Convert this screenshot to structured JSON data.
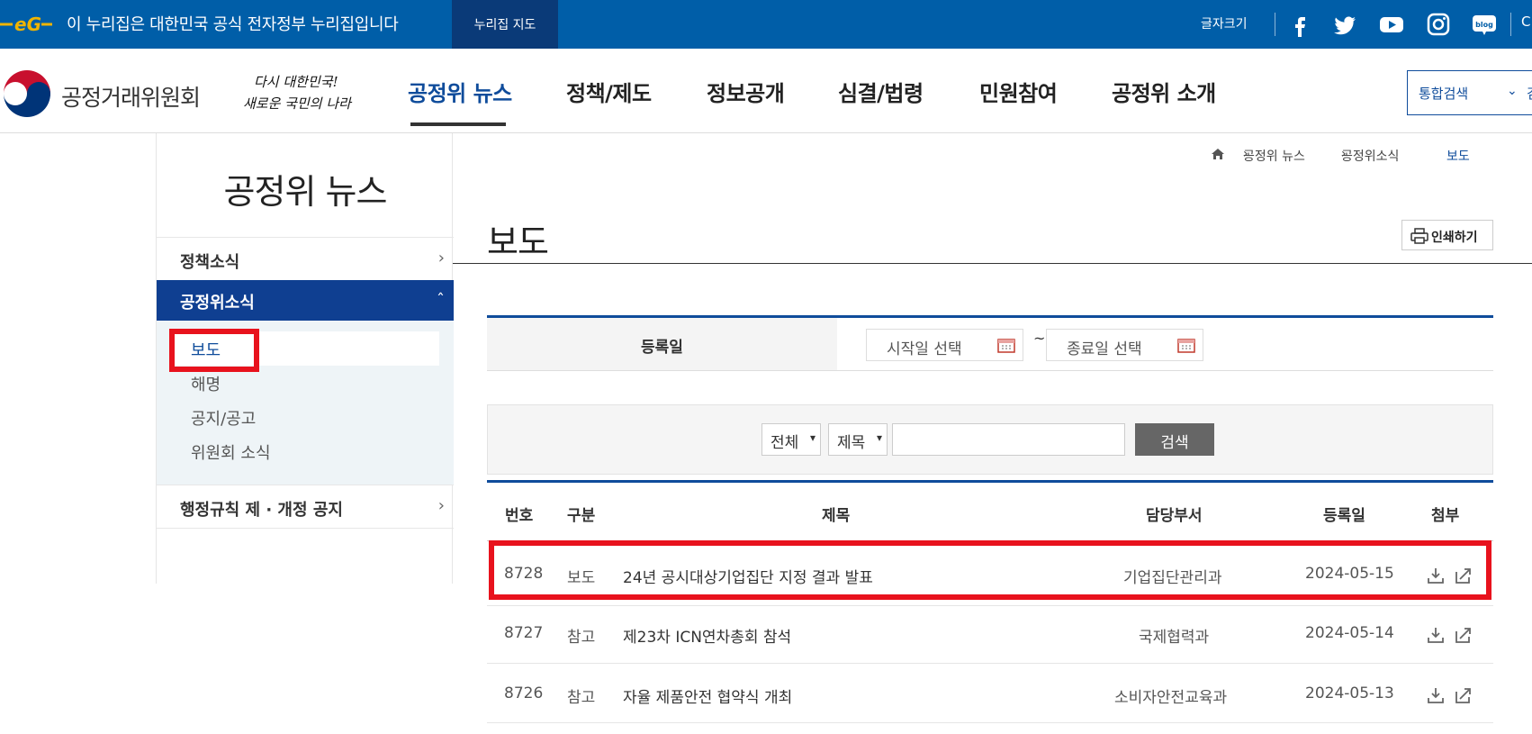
{
  "topbar": {
    "gov_text": "이 누리집은 대한민국 공식 전자정부 누리집입니다",
    "nuri_map": "누리집 지도",
    "font_size": "글자크기",
    "sns": [
      "facebook-icon",
      "twitter-icon",
      "youtube-icon",
      "instagram-icon",
      "blog-icon"
    ],
    "blog_label": "blog",
    "cut_text": "C"
  },
  "header": {
    "org_name": "공정거래위원회",
    "slogan_line1": "다시 대한민국!",
    "slogan_line2": "새로운 국민의 나라",
    "gnb": [
      "공정위 뉴스",
      "정책/제도",
      "정보공개",
      "심결/법령",
      "민원참여",
      "공정위 소개"
    ],
    "search_select": "통합검색",
    "search_cut": "검"
  },
  "sidenav": {
    "title": "공정위 뉴스",
    "groups": [
      "정책소식",
      "공정위소식",
      "행정규칙 제 · 개정 공지"
    ],
    "sub_items": [
      "보도",
      "해명",
      "공지/공고",
      "위원회 소식"
    ]
  },
  "breadcrumb": [
    "공정위 뉴스",
    "공정위소식",
    "보도"
  ],
  "page": {
    "title": "보도",
    "print": "인쇄하기"
  },
  "filter": {
    "date_label": "등록일",
    "start_placeholder": "시작일 선택",
    "end_placeholder": "종료일 선택",
    "tilde": "~",
    "scope": "전체",
    "field": "제목",
    "keyword": "",
    "search": "검색"
  },
  "table": {
    "headers": [
      "번호",
      "구분",
      "제목",
      "담당부서",
      "등록일",
      "첨부"
    ],
    "rows": [
      {
        "no": "8728",
        "type": "보도",
        "title": "24년 공시대상기업집단 지정 결과 발표",
        "dept": "기업집단관리과",
        "date": "2024-05-15"
      },
      {
        "no": "8727",
        "type": "참고",
        "title": "제23차 ICN연차총회 참석",
        "dept": "국제협력과",
        "date": "2024-05-14"
      },
      {
        "no": "8726",
        "type": "참고",
        "title": "자율 제품안전 협약식 개최",
        "dept": "소비자안전교육과",
        "date": "2024-05-13"
      }
    ]
  },
  "colors": {
    "primary": "#005ea8",
    "navy": "#0f3f91",
    "highlight": "#e8121d"
  }
}
